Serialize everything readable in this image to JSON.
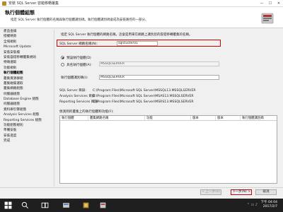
{
  "window": {
    "title": "安裝 SQL Server 容錯移轉叢集",
    "minimize": "—",
    "maximize": "☐",
    "close": "✕"
  },
  "header": {
    "title": "執行個體組態",
    "description": "指定 SQL Server 執行個體的名稱與執行個體識別碼。執行個體識別碼會成為安裝路徑的一部分。"
  },
  "sidebar": {
    "items": [
      {
        "label": "產品金鑰",
        "active": false
      },
      {
        "label": "授權條款",
        "active": false
      },
      {
        "label": "全域規則",
        "active": false
      },
      {
        "label": "Microsoft Update",
        "active": false
      },
      {
        "label": "安裝安裝檔",
        "active": false
      },
      {
        "label": "安裝容錯移轉叢集規則",
        "active": false
      },
      {
        "label": "特徵選取",
        "active": false
      },
      {
        "label": "功能規則",
        "active": false
      },
      {
        "label": "執行個體組態",
        "active": true
      },
      {
        "label": "叢集資源群組",
        "active": false
      },
      {
        "label": "叢集磁碟選取",
        "active": false
      },
      {
        "label": "叢集網路組態",
        "active": false
      },
      {
        "label": "伺服器組態",
        "active": false
      },
      {
        "label": "Database Engine 組態",
        "active": false
      },
      {
        "label": "伺服器組態",
        "active": false
      },
      {
        "label": "資料庫引擎組態",
        "active": false
      },
      {
        "label": "Analysis Services 組態",
        "active": false
      },
      {
        "label": "Reporting Services 組態",
        "active": false
      },
      {
        "label": "功能組態規則",
        "active": false
      },
      {
        "label": "準備安裝",
        "active": false
      },
      {
        "label": "安裝進度",
        "active": false
      },
      {
        "label": "完成",
        "active": false
      }
    ]
  },
  "main": {
    "instruction": "指定 SQL Server 執行個體的網路名稱。這會是用來在網路上識別您的容錯移轉叢集的名稱。",
    "network_name_label": "SQL Server 網路名稱(N):",
    "network_name_value": "sqlcluster01",
    "default_instance_label": "預設執行個體(D)",
    "named_instance_label": "具名執行個體(A):",
    "named_instance_value": "MSSQLSERVER",
    "instance_id_label": "執行個體識別碼(I):",
    "instance_id_value": "MSSQLSERVER",
    "paths": [
      {
        "key": "SQL Server 目錄:",
        "value": "C:\\Program Files\\Microsoft SQL Server\\MSSQL13.MSSQLSERVER"
      },
      {
        "key": "Analysis Services 目錄:",
        "value": "C:\\Program Files\\Microsoft SQL Server\\MSAS13.MSSQLSERVER"
      },
      {
        "key": "Reporting Services 目錄:",
        "value": "C:\\Program Files\\Microsoft SQL Server\\MSRS13.MSSQLSERVER"
      }
    ],
    "installed_label": "偵測到的叢集上的執行個體和功能(F):",
    "grid_headers": [
      "執行個體",
      "叢集網路名稱",
      "功能",
      "版本",
      "版本",
      "執行個體識別碼"
    ]
  },
  "footer": {
    "back": "< 上一步(B)",
    "next": "下一步(N) >",
    "cancel": "取消"
  },
  "taskbar": {
    "time": "下午 04:04",
    "date": "2017/2/7",
    "start_icon": "windows-icon",
    "search_icon": "search-icon",
    "taskview_icon": "task-view-icon"
  },
  "colors": {
    "highlight_border": "#d40000",
    "taskbar": "#1f1f1f"
  }
}
